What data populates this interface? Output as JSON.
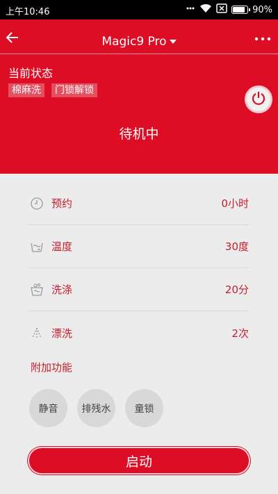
{
  "statusbar": {
    "time": "上午10:46",
    "battery_pct": "90%",
    "battery_level": 0.9
  },
  "header": {
    "title": "Magic9 Pro"
  },
  "state": {
    "label": "当前状态",
    "tags": [
      "棉麻洗",
      "门锁解锁"
    ],
    "status": "待机中"
  },
  "settings": [
    {
      "label": "预约",
      "value": "0小时",
      "icon": "clock-icon"
    },
    {
      "label": "温度",
      "value": "30度",
      "icon": "temperature-icon"
    },
    {
      "label": "洗涤",
      "value": "20分",
      "icon": "wash-icon"
    },
    {
      "label": "漂洗",
      "value": "2次",
      "icon": "rinse-icon"
    }
  ],
  "extras": {
    "label": "附加功能",
    "buttons": [
      "静音",
      "排残水",
      "童锁"
    ]
  },
  "start_label": "启动",
  "colors": {
    "primary": "#dc0d24",
    "accent_text": "#c51d2b",
    "background": "#ececec"
  }
}
